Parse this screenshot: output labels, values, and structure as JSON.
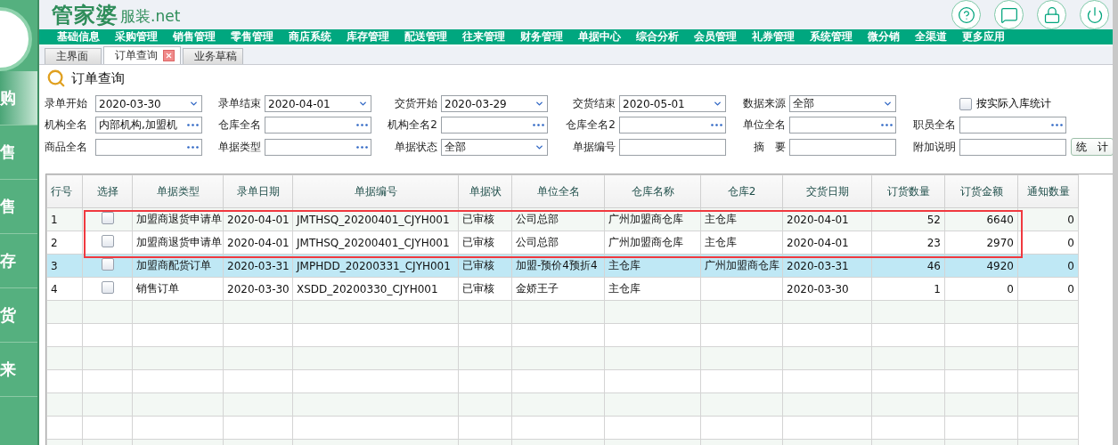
{
  "sidebar": {
    "items": [
      {
        "label": "购",
        "selected": true
      },
      {
        "label": "售",
        "selected": false
      },
      {
        "label": "售",
        "selected": false
      },
      {
        "label": "存",
        "selected": false
      },
      {
        "label": "货",
        "selected": false
      },
      {
        "label": "来",
        "selected": false
      }
    ]
  },
  "header": {
    "logo": {
      "brand": "管家婆",
      "suffix": "服装.net"
    },
    "actions": [
      {
        "kind": "help"
      },
      {
        "kind": "message"
      },
      {
        "kind": "lock"
      },
      {
        "kind": "power"
      }
    ]
  },
  "menu": [
    "基础信息",
    "采购管理",
    "销售管理",
    "零售管理",
    "商店系统",
    "库存管理",
    "配送管理",
    "往来管理",
    "财务管理",
    "单据中心",
    "综合分析",
    "会员管理",
    "礼券管理",
    "系统管理",
    "微分销",
    "全渠道",
    "更多应用"
  ],
  "tabs": [
    {
      "label": "主界面",
      "selected": false,
      "closable": false
    },
    {
      "label": "订单查询",
      "selected": true,
      "closable": true
    },
    {
      "label": "业务草稿",
      "selected": false,
      "closable": false
    }
  ],
  "page_title": "订单查询",
  "filters": [
    [
      {
        "kind": "dropdown",
        "label": "录单开始",
        "value": "2020-03-30"
      },
      {
        "kind": "dropdown",
        "label": "录单结束",
        "value": "2020-04-01"
      },
      {
        "kind": "dropdown",
        "label": "交货开始",
        "value": "2020-03-29"
      },
      {
        "kind": "dropdown",
        "label": "交货结束",
        "value": "2020-05-01"
      },
      {
        "kind": "dropdown",
        "label": "数据来源",
        "value": "全部"
      },
      {
        "kind": "checkbox",
        "label": "按实际入库统计",
        "checked": false
      }
    ],
    [
      {
        "kind": "lookup",
        "label": "机构全名",
        "value": "内部机构,加盟机"
      },
      {
        "kind": "lookup",
        "label": "仓库全名"
      },
      {
        "kind": "lookup",
        "label": "机构全名2"
      },
      {
        "kind": "lookup",
        "label": "仓库全名2"
      },
      {
        "kind": "lookup",
        "label": "单位全名"
      },
      {
        "kind": "lookup",
        "label": "职员全名"
      }
    ],
    [
      {
        "kind": "lookup",
        "label": "商品全名"
      },
      {
        "kind": "lookup",
        "label": "单据类型"
      },
      {
        "kind": "dropdown",
        "label": "单据状态",
        "value": "全部"
      },
      {
        "kind": "text",
        "label": "单据编号"
      },
      {
        "kind": "text",
        "label": "摘　要"
      },
      {
        "kind": "text",
        "label": "附加说明"
      },
      {
        "kind": "button",
        "label": "统　计"
      }
    ]
  ],
  "table": {
    "columns": [
      "行号",
      "选择",
      "单据类型",
      "录单日期",
      "单据编号",
      "单据状",
      "单位全名",
      "仓库名称",
      "仓库2",
      "交货日期",
      "订货数量",
      "订货金额",
      "通知数量"
    ],
    "rows": [
      {
        "selected": false,
        "checked": false,
        "cells": [
          "1",
          "",
          "加盟商退货申请单",
          "2020-04-01",
          "JMTHSQ_20200401_CJYH001",
          "已审核",
          "公司总部",
          "广州加盟商仓库",
          "主仓库",
          "2020-04-01",
          "52",
          "6640",
          "0"
        ]
      },
      {
        "selected": false,
        "checked": false,
        "cells": [
          "2",
          "",
          "加盟商退货申请单",
          "2020-04-01",
          "JMTHSQ_20200401_CJYH001",
          "已审核",
          "公司总部",
          "广州加盟商仓库",
          "主仓库",
          "2020-04-01",
          "23",
          "2970",
          "0"
        ]
      },
      {
        "selected": true,
        "checked": false,
        "cells": [
          "3",
          "",
          "加盟商配货订单",
          "2020-03-31",
          "JMPHDD_20200331_CJYH001",
          "已审核",
          "加盟-预价4预折4",
          "主仓库",
          "广州加盟商仓库",
          "2020-03-31",
          "46",
          "4920",
          "0"
        ]
      },
      {
        "selected": false,
        "checked": false,
        "cells": [
          "4",
          "",
          "销售订单",
          "2020-03-30",
          "XSDD_20200330_CJYH001",
          "已审核",
          "金娇王子",
          "主仓库",
          "",
          "2020-03-30",
          "1",
          "0",
          "0"
        ]
      }
    ],
    "highlight": true
  }
}
